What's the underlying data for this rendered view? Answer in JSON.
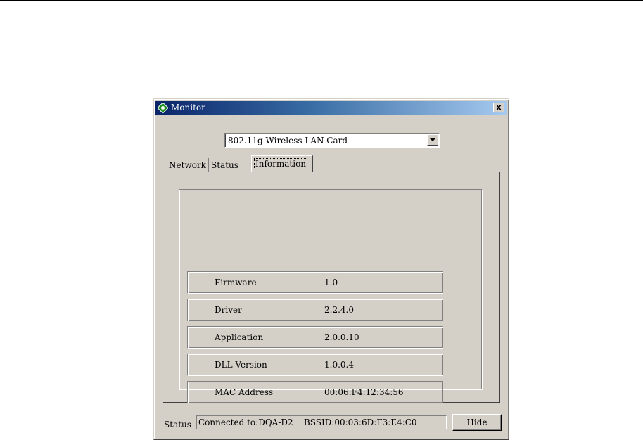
{
  "window": {
    "title": "Monitor",
    "close_symbol": "x"
  },
  "adapter": {
    "selected": "802.11g Wireless LAN Card"
  },
  "tabs": [
    {
      "label": "Network"
    },
    {
      "label": "Status"
    },
    {
      "label": "Information",
      "active": true
    }
  ],
  "information": [
    {
      "label": "Firmware",
      "value": "1.0"
    },
    {
      "label": "Driver",
      "value": "2.2.4.0"
    },
    {
      "label": "Application",
      "value": "2.0.0.10"
    },
    {
      "label": "DLL Version",
      "value": "1.0.0.4"
    },
    {
      "label": "MAC Address",
      "value": "00:06:F4:12:34:56"
    }
  ],
  "status_bar": {
    "label": "Status",
    "text": "Connected to:DQA-D2    BSSID:00:03:6D:F3:E4:C0",
    "hide_label": "Hide"
  },
  "colors": {
    "title_start": "#0a246a",
    "title_end": "#a6caf0",
    "window_bg": "#d4d0c8"
  }
}
